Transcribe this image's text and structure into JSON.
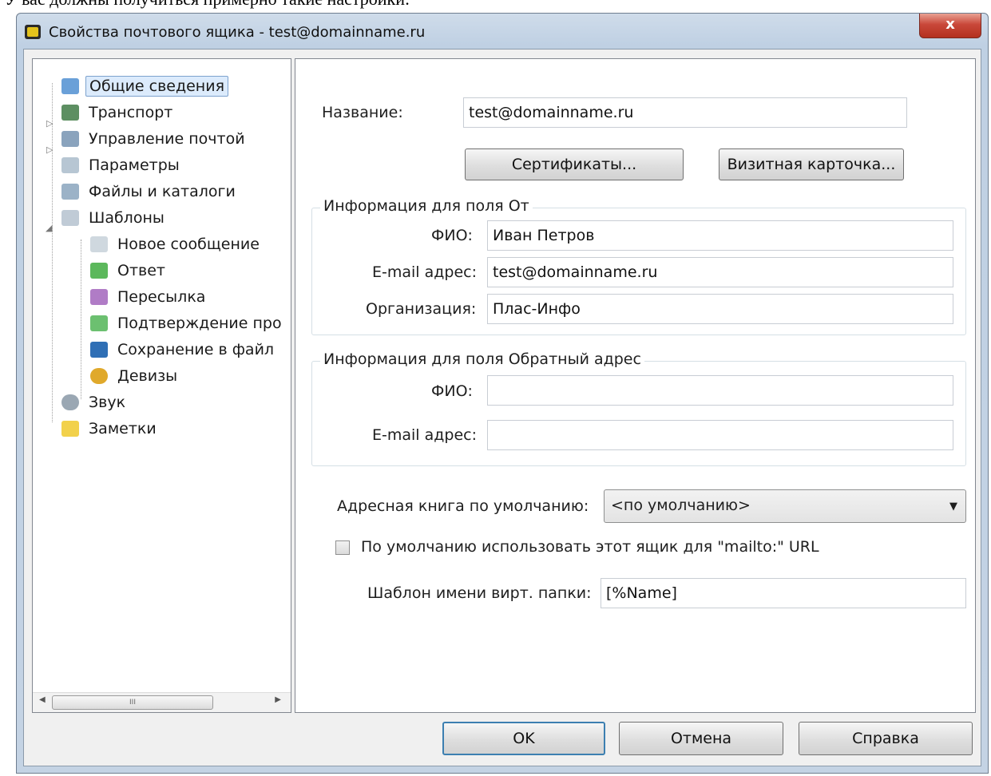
{
  "page_caption": "У вас должны получиться примерно такие настройки:",
  "window": {
    "title": "Свойства почтового ящика - test@domainname.ru",
    "close_glyph": "x"
  },
  "tree": {
    "items": [
      {
        "label": "Общие сведения",
        "icon": "general-info-icon",
        "selected": true
      },
      {
        "label": "Транспорт",
        "icon": "transport-icon"
      },
      {
        "label": "Управление почтой",
        "icon": "mail-management-icon"
      },
      {
        "label": "Параметры",
        "icon": "parameters-icon"
      },
      {
        "label": "Файлы и каталоги",
        "icon": "files-folders-icon"
      },
      {
        "label": "Шаблоны",
        "icon": "templates-icon",
        "expanded": true
      },
      {
        "label": "Новое сообщение",
        "icon": "new-message-icon"
      },
      {
        "label": "Ответ",
        "icon": "reply-icon"
      },
      {
        "label": "Пересылка",
        "icon": "forward-icon"
      },
      {
        "label": "Подтверждение про",
        "icon": "confirmation-icon"
      },
      {
        "label": "Сохранение в файл",
        "icon": "save-to-file-icon"
      },
      {
        "label": "Девизы",
        "icon": "mottos-icon"
      },
      {
        "label": "Звук",
        "icon": "sound-icon"
      },
      {
        "label": "Заметки",
        "icon": "notes-icon"
      }
    ],
    "scroll_thumb_grip": "III"
  },
  "form": {
    "name_label": "Название:",
    "name_value": "test@domainname.ru",
    "certificates_button": "Сертификаты...",
    "vcard_button": "Визитная карточка...",
    "from_group": {
      "title": "Информация для поля От",
      "fio_label": "ФИО:",
      "fio_value": "Иван Петров",
      "email_label": "E-mail адрес:",
      "email_value": "test@domainname.ru",
      "org_label": "Организация:",
      "org_value": "Плас-Инфо"
    },
    "reply_group": {
      "title": "Информация для поля Обратный адрес",
      "fio_label": "ФИО:",
      "fio_value": "",
      "email_label": "E-mail адрес:",
      "email_value": ""
    },
    "addressbook_label": "Адресная книга по умолчанию:",
    "addressbook_value": "<по умолчанию>",
    "mailto_checkbox_label": "По умолчанию использовать этот ящик для \"mailto:\" URL",
    "mailto_checked": false,
    "vfolder_label": "Шаблон имени вирт. папки:",
    "vfolder_value": "[%Name]"
  },
  "buttons": {
    "ok": "OK",
    "cancel": "Отмена",
    "help": "Справка"
  },
  "colors": {
    "window_frame": "#c4d3e4",
    "selection": "#dcebfc",
    "close_button": "#c9483a"
  }
}
